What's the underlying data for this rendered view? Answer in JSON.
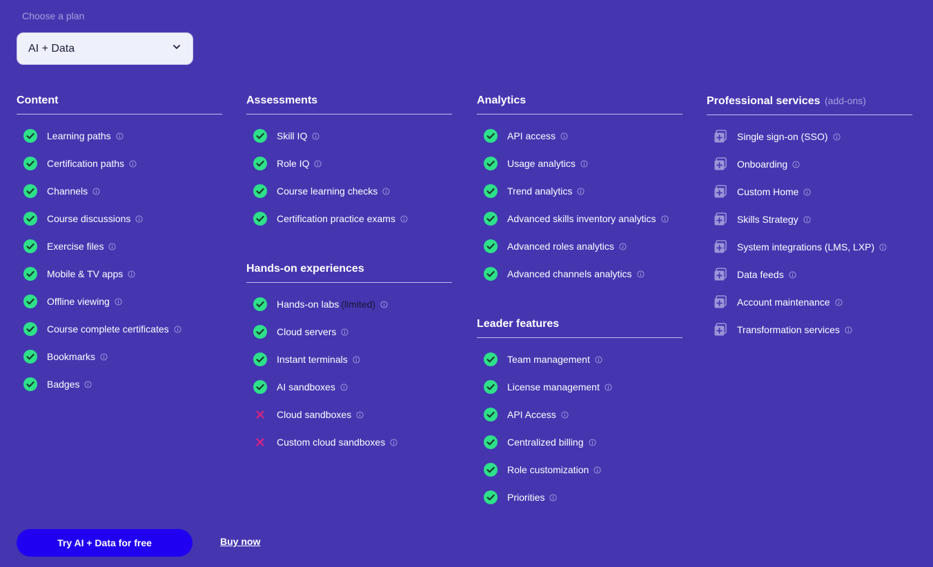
{
  "plan": {
    "label": "Choose a plan",
    "selected": "AI + Data"
  },
  "columns": [
    {
      "sections": [
        {
          "title": "Content",
          "items": [
            {
              "label": "Learning paths",
              "status": "included"
            },
            {
              "label": "Certification paths",
              "status": "included"
            },
            {
              "label": "Channels",
              "status": "included"
            },
            {
              "label": "Course discussions",
              "status": "included"
            },
            {
              "label": "Exercise files",
              "status": "included"
            },
            {
              "label": "Mobile & TV apps",
              "status": "included"
            },
            {
              "label": "Offline viewing",
              "status": "included"
            },
            {
              "label": "Course complete certificates",
              "status": "included"
            },
            {
              "label": "Bookmarks",
              "status": "included"
            },
            {
              "label": "Badges",
              "status": "included"
            }
          ]
        }
      ]
    },
    {
      "sections": [
        {
          "title": "Assessments",
          "items": [
            {
              "label": "Skill IQ",
              "status": "included"
            },
            {
              "label": "Role IQ",
              "status": "included"
            },
            {
              "label": "Course learning checks",
              "status": "included"
            },
            {
              "label": "Certification practice exams",
              "status": "included"
            }
          ]
        },
        {
          "title": "Hands-on experiences",
          "items": [
            {
              "label": "Hands-on labs",
              "note": "(limited)",
              "status": "included"
            },
            {
              "label": "Cloud servers",
              "status": "included"
            },
            {
              "label": "Instant terminals",
              "status": "included"
            },
            {
              "label": "AI sandboxes",
              "status": "included"
            },
            {
              "label": "Cloud sandboxes",
              "status": "excluded"
            },
            {
              "label": "Custom cloud sandboxes",
              "status": "excluded"
            }
          ]
        }
      ]
    },
    {
      "sections": [
        {
          "title": "Analytics",
          "items": [
            {
              "label": "API access",
              "status": "included"
            },
            {
              "label": "Usage analytics",
              "status": "included"
            },
            {
              "label": "Trend analytics",
              "status": "included"
            },
            {
              "label": "Advanced skills inventory analytics",
              "status": "included"
            },
            {
              "label": "Advanced roles analytics",
              "status": "included"
            },
            {
              "label": "Advanced channels analytics",
              "status": "included"
            }
          ]
        },
        {
          "title": "Leader features",
          "items": [
            {
              "label": "Team management",
              "status": "included"
            },
            {
              "label": "License management",
              "status": "included"
            },
            {
              "label": "API Access",
              "status": "included"
            },
            {
              "label": "Centralized billing",
              "status": "included"
            },
            {
              "label": "Role customization",
              "status": "included"
            },
            {
              "label": "Priorities",
              "status": "included"
            }
          ]
        }
      ]
    },
    {
      "sections": [
        {
          "title": "Professional services",
          "subtitle": "(add-ons)",
          "items": [
            {
              "label": "Single sign-on (SSO)",
              "status": "addon"
            },
            {
              "label": "Onboarding",
              "status": "addon"
            },
            {
              "label": "Custom Home",
              "status": "addon"
            },
            {
              "label": "Skills Strategy",
              "status": "addon"
            },
            {
              "label": "System integrations (LMS, LXP)",
              "status": "addon"
            },
            {
              "label": "Data feeds",
              "status": "addon"
            },
            {
              "label": "Account maintenance",
              "status": "addon"
            },
            {
              "label": "Transformation services",
              "status": "addon"
            }
          ]
        }
      ]
    }
  ],
  "actions": {
    "try_label": "Try AI + Data for free",
    "buy_label": "Buy now"
  },
  "icons": {
    "included": "check-circle-icon",
    "excluded": "x-icon",
    "addon": "add-on-icon",
    "info": "info-icon"
  },
  "colors": {
    "background": "#4536b0",
    "check": "#2ee08a",
    "cross": "#e8207a",
    "addon": "#9d95d8",
    "primary_button": "#1f00f0"
  }
}
